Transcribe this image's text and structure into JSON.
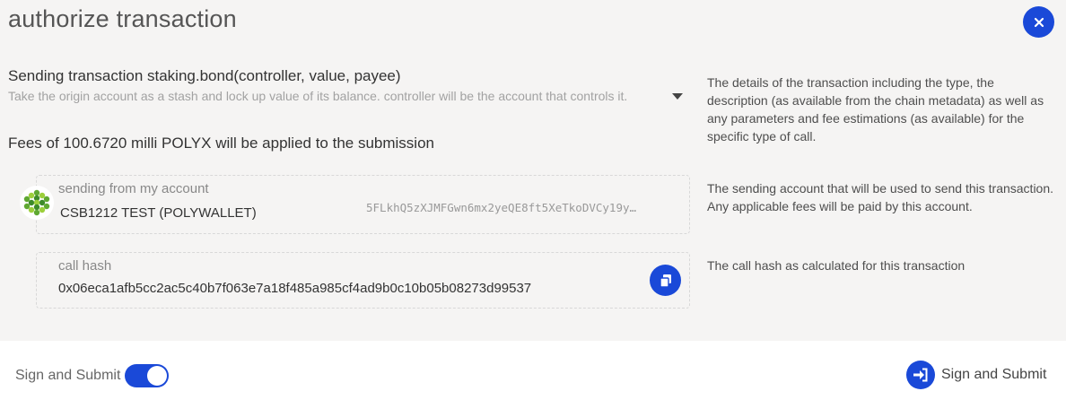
{
  "header": {
    "title": "authorize transaction"
  },
  "transaction": {
    "heading": "Sending transaction staking.bond(controller, value, payee)",
    "description": "Take the origin account as a stash and lock up value of its balance. controller will be the account that controls it.",
    "fees": "Fees of 100.6720 milli POLYX will be applied to the submission"
  },
  "sender": {
    "label": "sending from my account",
    "account_name": "CSB1212 TEST (POLYWALLET)",
    "address": "5FLkhQ5zXJMFGwn6mx2yeQE8ft5XeTkoDVCy19y…"
  },
  "call_hash": {
    "label": "call hash",
    "value": "0x06eca1afb5cc2ac5c40b7f063e7a18f485a985cf4ad9b0c10b05b08273d99537"
  },
  "help": {
    "details": "The details of the transaction including the type, the description (as available from the chain metadata) as well as any parameters and fee estimations (as available) for the specific type of call.",
    "sender": "The sending account that will be used to send this transaction. Any applicable fees will be paid by this account.",
    "call_hash": "The call hash as calculated for this transaction"
  },
  "footer": {
    "toggle_label": "Sign and Submit",
    "toggle_on": true,
    "submit_label": "Sign and Submit"
  },
  "icons": {
    "close": "close-icon",
    "expand": "caret-down-icon",
    "copy": "copy-icon",
    "submit": "sign-in-icon",
    "avatar": "identicon"
  },
  "colors": {
    "accent": "#1a49d8",
    "background": "#f5f4f3",
    "footer_background": "#ffffff"
  }
}
